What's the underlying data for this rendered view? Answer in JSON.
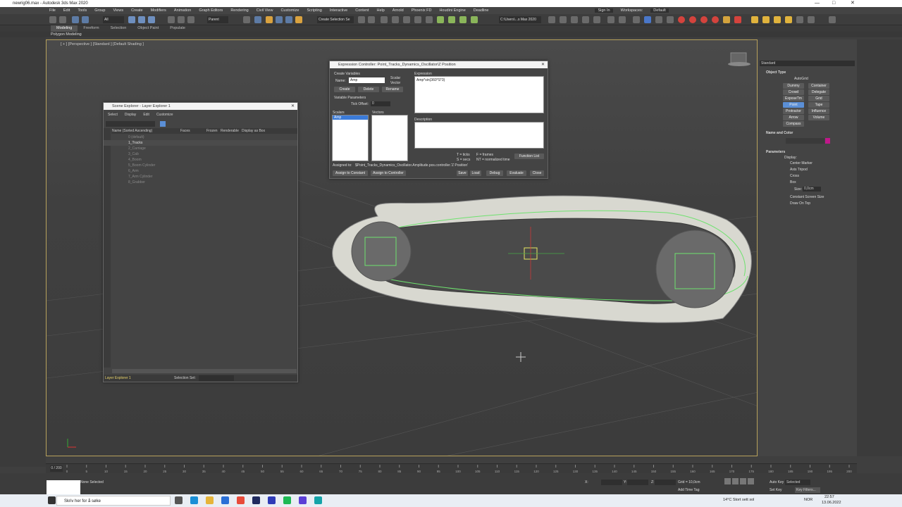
{
  "app": {
    "title": "newrig06.max - Autodesk 3ds Max 2020",
    "sign_in": "Sign In",
    "workspaces_label": "Workspaces:",
    "workspaces_value": "Default"
  },
  "menu": [
    "File",
    "Edit",
    "Tools",
    "Group",
    "Views",
    "Create",
    "Modifiers",
    "Animation",
    "Graph Editors",
    "Rendering",
    "Civil View",
    "Customize",
    "Scripting",
    "Interactive",
    "Content",
    "Help",
    "Arnold",
    "Phoenix FD",
    "Houdini Engine",
    "Deadline"
  ],
  "toolbar": {
    "filter": "All",
    "refcoord": "Parent",
    "selection_set": "Create Selection Se",
    "path": "C:\\Users\\...s Max 2020"
  },
  "ribbon": {
    "tabs": [
      "Modeling",
      "Freeform",
      "Selection",
      "Object Paint",
      "Populate"
    ],
    "active": "Modeling",
    "sub": "Polygon Modeling"
  },
  "viewport": {
    "label": "[ + ] [Perspective ] [Standard ] [Default Shading ]"
  },
  "scene_explorer": {
    "title": "Scene Explorer - Layer Explorer 1",
    "menu": [
      "Select",
      "Display",
      "Edit",
      "Customize"
    ],
    "columns": [
      "Name (Sorted Ascending)",
      "Faces",
      "Frozen",
      "Renderable",
      "Display as Box"
    ],
    "layers": [
      "0 (default)",
      "1_Tracks",
      "2_Carriage",
      "3_Cab",
      "4_Boom",
      "5_Boom Cylinder",
      "6_Arm",
      "7_Arm Cylinder",
      "8_Grabber"
    ],
    "footer_name": "Layer Explorer 1",
    "footer_selset": "Selection Set:"
  },
  "expr": {
    "title": "Expression Controller: Point_Tracks_Dynamics_Oscillator\\Z Position",
    "create_vars": "Create Variables",
    "name_label": "Name:",
    "name_value": "Amp",
    "scalar": "Scalar",
    "vector": "Vector",
    "create": "Create",
    "delete": "Delete",
    "rename": "Rename",
    "var_params": "Variable Parameters",
    "tick_offset": "Tick Offset:",
    "tick_value": "0",
    "scalars": "Scalars",
    "vectors": "Vectors",
    "scalar_item": "Amp",
    "expression_label": "Expression",
    "expression": "Amp*sin(360*S*3)",
    "description": "Description",
    "legend1": "T = ticks",
    "legend2": "S = secs",
    "legend3": "F = frames",
    "legend4": "NT = normalized time",
    "function_list": "Function List",
    "assigned_to": "Assigned to:",
    "assigned_value": "$Point_Tracks_Dynamics_Oscillator.Amplitude.pos.controller.'Z Position'",
    "assign_const": "Assign to Constant",
    "assign_ctrl": "Assign to Controller",
    "save": "Save",
    "load": "Load",
    "debug": "Debug",
    "evaluate": "Evaluate",
    "close": "Close"
  },
  "cmd": {
    "dropdown": "Standard",
    "object_type": "Object Type",
    "autogrid": "AutoGrid",
    "buttons": [
      "Dummy",
      "Container",
      "Crowd",
      "Delegate",
      "ExposeTm",
      "Grid",
      "Point",
      "Tape",
      "Protractor",
      "Influence",
      "Arrow",
      "Volume",
      "Compass"
    ],
    "name_color": "Name and Color",
    "parameters": "Parameters",
    "display": "Display:",
    "options": [
      "Center Marker",
      "Axis Tripod",
      "Cross",
      "Box"
    ],
    "size_label": "Size:",
    "size_value": "0,0cm",
    "constant": "Constant Screen Size",
    "draw_top": "Draw On Top"
  },
  "timeline": {
    "frame": "0 / 200",
    "ticks": [
      "0",
      "5",
      "10",
      "15",
      "20",
      "25",
      "30",
      "35",
      "40",
      "45",
      "50",
      "55",
      "60",
      "65",
      "70",
      "75",
      "80",
      "85",
      "90",
      "95",
      "100",
      "105",
      "110",
      "115",
      "120",
      "125",
      "130",
      "135",
      "140",
      "145",
      "150",
      "155",
      "160",
      "165",
      "170",
      "175",
      "180",
      "185",
      "190",
      "195",
      "200"
    ]
  },
  "status": {
    "sel": "None Selected",
    "x": "X:",
    "y": "Y:",
    "z": "Z:",
    "grid": "Grid = 10,0cm",
    "add_time": "Add Time Tag",
    "autokey": "Auto Key",
    "selected": "Selected",
    "setkey": "Set Key",
    "keyfilters": "Key Filters..."
  },
  "taskbar": {
    "search": "Skriv her for å søke",
    "weather": "14°C  Stort sett sol",
    "lang": "NOR",
    "time": "22:57",
    "date": "13.06.2022"
  }
}
